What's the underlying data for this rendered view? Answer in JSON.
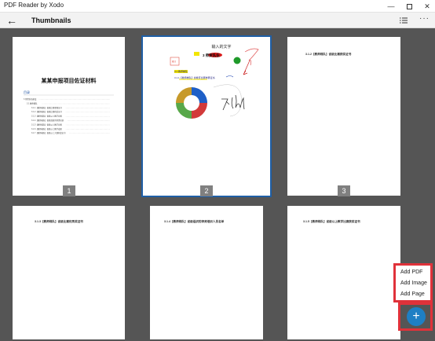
{
  "window": {
    "title": "PDF Reader by Xodo",
    "minimize": "—",
    "close": "✕"
  },
  "toolbar": {
    "back": "←",
    "title": "Thumbnails",
    "more": "···"
  },
  "pages": {
    "p1": {
      "number": "1",
      "title": "某某申报项目佐证材料",
      "toc_heading": "目录",
      "toc": [
        "3 师资队伍建设",
        "3.1 教师梯队",
        "3.1.1【教师梯队】省级比赛参赛证书",
        "3.1.2【教师梯队】省级比赛获奖证书",
        "3.1.3【教师梯队】省级以上教学比赛",
        "3.1.4【教师梯队】省级组织的师资培训",
        "3.1.5【教师梯队】省级以上教学比赛",
        "3.1.6【教师梯队】省级以上教学成果",
        "3.1.7【教师梯队】省级以上大赛获奖证书"
      ]
    },
    "p2": {
      "number": "2",
      "insert_text": "输入的文字",
      "heading": "3 师资队伍",
      "sub1": "3.1 教师梯队",
      "sub2": "3.1.1【教师梯队】省教育比赛参赛证书",
      "note": "备注"
    },
    "p3": {
      "number": "3",
      "header": "3.1.2【教师梯队】省级比赛获奖证书"
    },
    "p4": {
      "header": "3.1.3【教师梯队】省级比赛优秀奖证书"
    },
    "p5": {
      "header": "3.1.4【教师梯队】省级组织的师资培训人员名单"
    },
    "p6": {
      "header": "3.1.5【教师梯队】省级以上教学比赛获奖证书"
    }
  },
  "fab": {
    "menu": [
      "Add PDF",
      "Add Image",
      "Add Page"
    ],
    "button": "+"
  },
  "colors": {
    "selection": "#1f5fa6",
    "fab": "#1e7fc4",
    "highlight": "#e0323a"
  }
}
